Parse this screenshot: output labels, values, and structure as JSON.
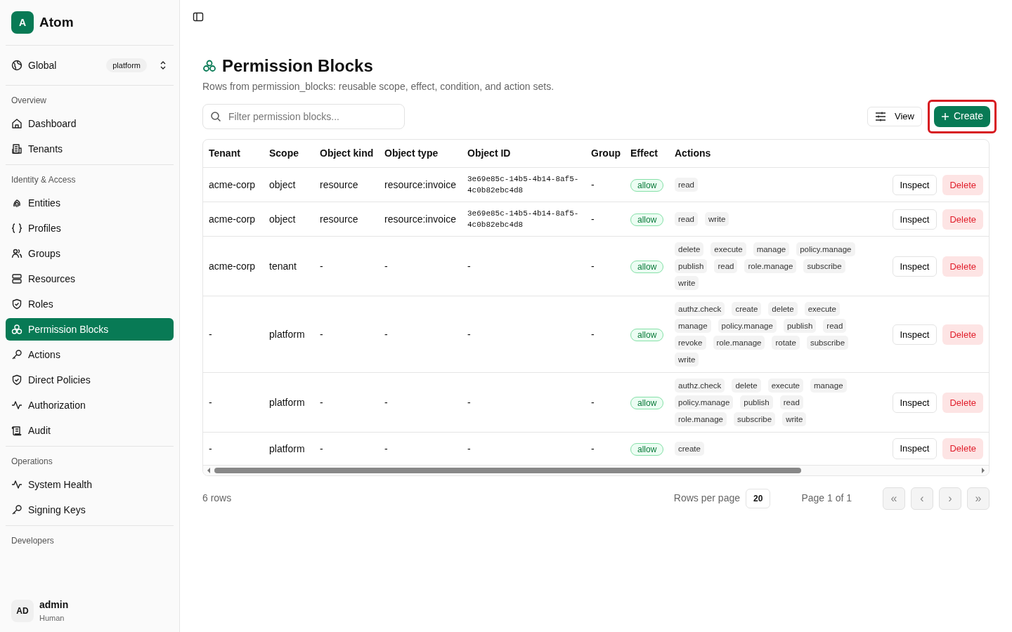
{
  "app": {
    "logo_letter": "A",
    "name": "Atom"
  },
  "scope_switcher": {
    "label": "Global",
    "badge": "platform"
  },
  "sidebar": {
    "sections": [
      {
        "label": "Overview",
        "items": [
          {
            "label": "Dashboard",
            "selected": false
          },
          {
            "label": "Tenants",
            "selected": false
          }
        ]
      },
      {
        "label": "Identity & Access",
        "items": [
          {
            "label": "Entities",
            "selected": false
          },
          {
            "label": "Profiles",
            "selected": false
          },
          {
            "label": "Groups",
            "selected": false
          },
          {
            "label": "Resources",
            "selected": false
          },
          {
            "label": "Roles",
            "selected": false
          },
          {
            "label": "Permission Blocks",
            "selected": true
          },
          {
            "label": "Actions",
            "selected": false
          },
          {
            "label": "Direct Policies",
            "selected": false
          },
          {
            "label": "Authorization",
            "selected": false
          },
          {
            "label": "Audit",
            "selected": false
          }
        ]
      },
      {
        "label": "Operations",
        "items": [
          {
            "label": "System Health",
            "selected": false
          },
          {
            "label": "Signing Keys",
            "selected": false
          }
        ]
      },
      {
        "label": "Developers"
      }
    ]
  },
  "user": {
    "initials": "AD",
    "name": "admin",
    "role": "Human"
  },
  "page": {
    "title": "Permission Blocks",
    "subtitle": "Rows from permission_blocks: reusable scope, effect, condition, and action sets."
  },
  "toolbar": {
    "search": {
      "placeholder": "Filter permission blocks..."
    },
    "view_button": "View",
    "create_button": {
      "label": "Create",
      "highlighted": true
    }
  },
  "table": {
    "columns": [
      "Tenant",
      "Scope",
      "Object kind",
      "Object type",
      "Object ID",
      "Group",
      "Effect",
      "Actions"
    ],
    "rows": [
      {
        "tenant": "acme-corp",
        "scope": "object",
        "object_kind": "resource",
        "object_type": "resource:invoice",
        "object_id": "3e69e85c-14b5-4b14-8af5-4c0b82ebc4d8",
        "group": "-",
        "effect": "allow",
        "actions": [
          "read"
        ],
        "inspect": "Inspect",
        "delete": "Delete"
      },
      {
        "tenant": "acme-corp",
        "scope": "object",
        "object_kind": "resource",
        "object_type": "resource:invoice",
        "object_id": "3e69e85c-14b5-4b14-8af5-4c0b82ebc4d8",
        "group": "-",
        "effect": "allow",
        "actions": [
          "read",
          "write"
        ],
        "inspect": "Inspect",
        "delete": "Delete"
      },
      {
        "tenant": "acme-corp",
        "scope": "tenant",
        "object_kind": "-",
        "object_type": "-",
        "object_id": "-",
        "group": "-",
        "effect": "allow",
        "actions": [
          "delete",
          "execute",
          "manage",
          "policy.manage",
          "publish",
          "read",
          "role.manage",
          "subscribe",
          "write"
        ],
        "inspect": "Inspect",
        "delete": "Delete"
      },
      {
        "tenant": "-",
        "scope": "platform",
        "object_kind": "-",
        "object_type": "-",
        "object_id": "-",
        "group": "-",
        "effect": "allow",
        "actions": [
          "authz.check",
          "create",
          "delete",
          "execute",
          "manage",
          "policy.manage",
          "publish",
          "read",
          "revoke",
          "role.manage",
          "rotate",
          "subscribe",
          "write"
        ],
        "inspect": "Inspect",
        "delete": "Delete"
      },
      {
        "tenant": "-",
        "scope": "platform",
        "object_kind": "-",
        "object_type": "-",
        "object_id": "-",
        "group": "-",
        "effect": "allow",
        "actions": [
          "authz.check",
          "delete",
          "execute",
          "manage",
          "policy.manage",
          "publish",
          "read",
          "role.manage",
          "subscribe",
          "write"
        ],
        "inspect": "Inspect",
        "delete": "Delete"
      },
      {
        "tenant": "-",
        "scope": "platform",
        "object_kind": "-",
        "object_type": "-",
        "object_id": "-",
        "group": "-",
        "effect": "allow",
        "actions": [
          "create"
        ],
        "inspect": "Inspect",
        "delete": "Delete"
      }
    ]
  },
  "footer": {
    "count": "6 rows",
    "rows_per_page_label": "Rows per page",
    "rows_per_page": "20",
    "page_info": "Page 1 of 1",
    "pager": [
      {
        "label": "«",
        "disabled": true
      },
      {
        "label": "‹",
        "disabled": true
      },
      {
        "label": "›",
        "disabled": true
      },
      {
        "label": "»",
        "disabled": true
      }
    ]
  }
}
